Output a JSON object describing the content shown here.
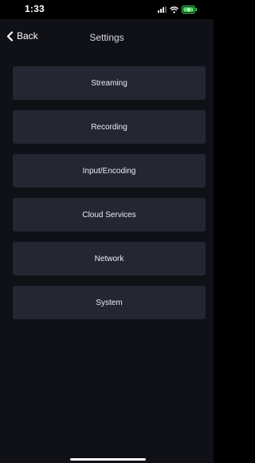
{
  "status_bar": {
    "time": "1:33",
    "icons": [
      "signal-icon",
      "wifi-icon",
      "battery-charging-icon"
    ],
    "battery_color": "#4cd964"
  },
  "nav": {
    "back_label": "Back",
    "title": "Settings"
  },
  "menu": {
    "items": [
      {
        "label": "Streaming"
      },
      {
        "label": "Recording"
      },
      {
        "label": "Input/Encoding"
      },
      {
        "label": "Cloud Services"
      },
      {
        "label": "Network"
      },
      {
        "label": "System"
      }
    ]
  },
  "colors": {
    "background": "#101116",
    "button": "#242632",
    "text": "#ececef"
  }
}
